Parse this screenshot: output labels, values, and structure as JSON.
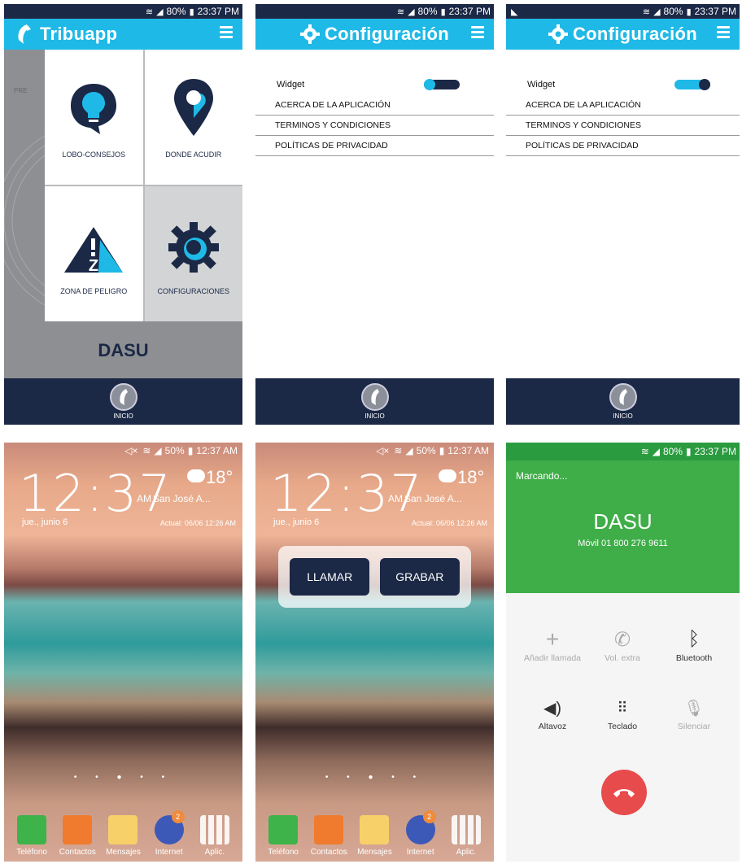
{
  "status_app": {
    "battery": "80%",
    "time": "23:37 PM"
  },
  "status_home": {
    "battery": "50%",
    "time": "12:37 AM"
  },
  "s1": {
    "title": "Tribuapp",
    "pre": "PRE",
    "tiles": [
      "LOBO-CONSEJOS",
      "DONDE ACUDIR",
      "ZONA DE PELIGRO",
      "CONFIGURACIONES"
    ],
    "contact": "DASU",
    "bottom": "INICIO"
  },
  "config": {
    "title": "Configuración",
    "widget": "Widget",
    "items": [
      "ACERCA DE LA APLICACIÓN",
      "TERMINOS Y CONDICIONES",
      "POLÍTICAS DE PRIVACIDAD"
    ],
    "bottom": "INICIO"
  },
  "home": {
    "clock": "12:37",
    "ampm": "AM",
    "location": "San José A...",
    "temp": "18°",
    "date": "jue., junio 6",
    "updated": "Actual: 06/06 12:26 AM",
    "dock": [
      "Teléfono",
      "Contactos",
      "Mensajes",
      "Internet",
      "Aplic."
    ],
    "internet_badge": "2"
  },
  "widget_popup": {
    "call": "LLAMAR",
    "record": "GRABAR"
  },
  "call": {
    "status": "Marcando...",
    "name": "DASU",
    "number": "Móvil  01 800 276 9611",
    "buttons": [
      "Añadir llamada",
      "Vol. extra",
      "Bluetooth",
      "Altavoz",
      "Teclado",
      "Silenciar"
    ]
  },
  "colors": {
    "navy": "#1b2846",
    "cyan": "#1fb9e7",
    "green": "#3fae49",
    "red": "#e84b4b"
  }
}
